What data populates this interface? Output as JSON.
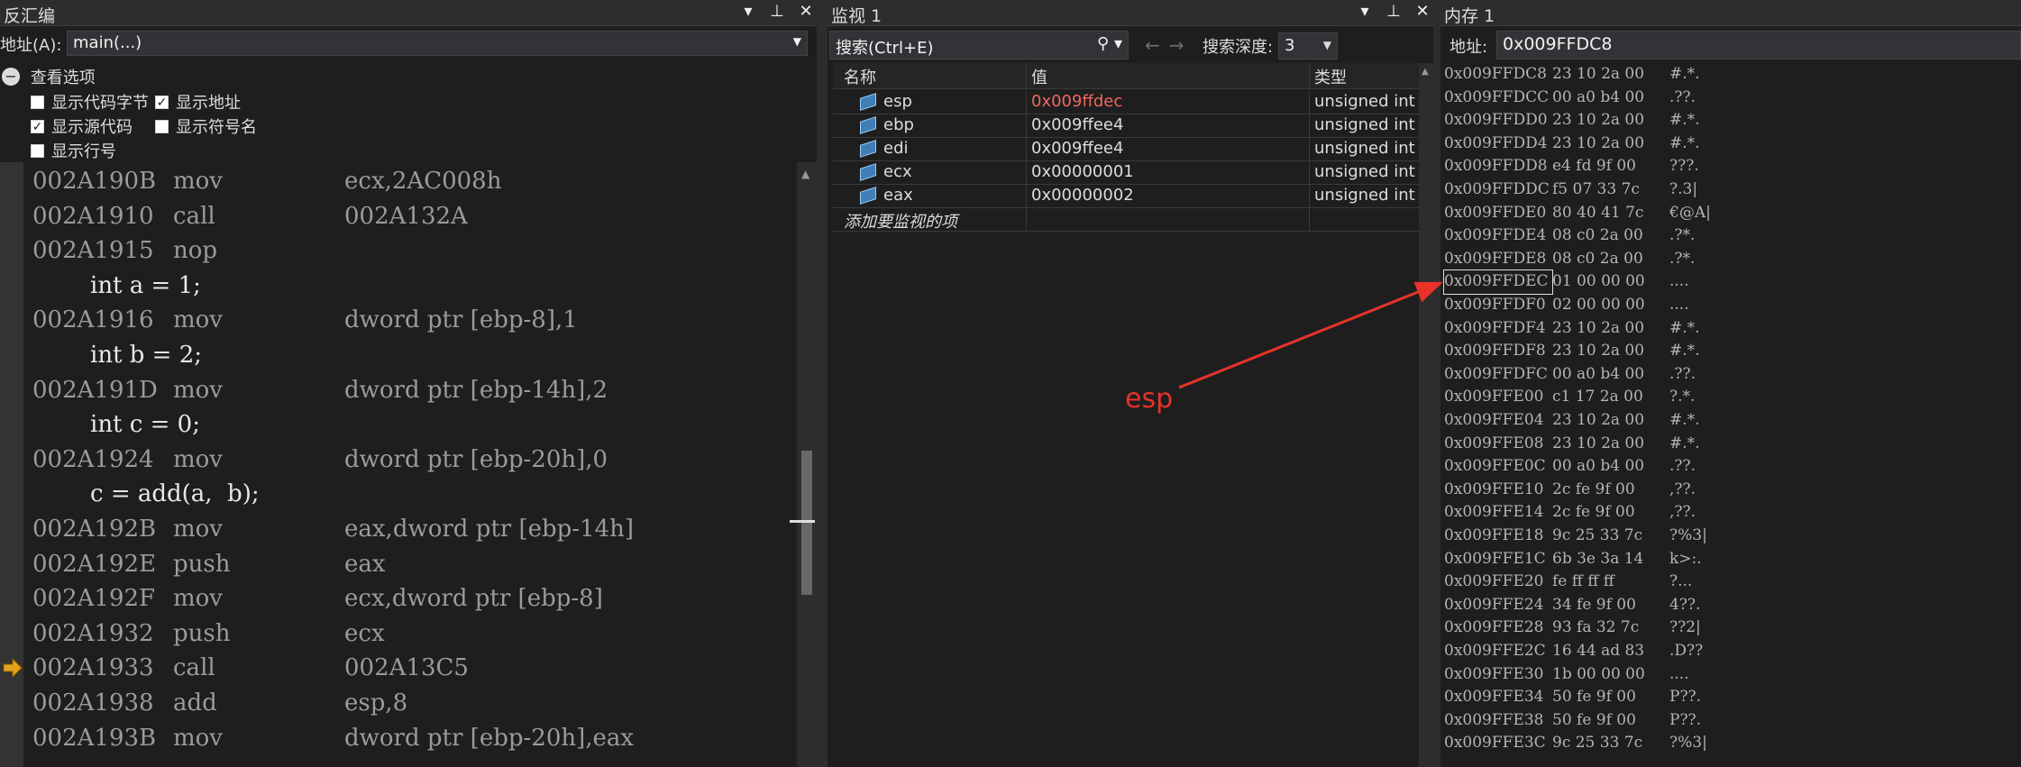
{
  "disassembly": {
    "title": "反汇编",
    "address_label": "地址(A):",
    "address_value": "main(...)",
    "options_header": "查看选项",
    "options": [
      {
        "label": "显示代码字节",
        "checked": false
      },
      {
        "label": "显示地址",
        "checked": true
      },
      {
        "label": "显示源代码",
        "checked": true
      },
      {
        "label": "显示符号名",
        "checked": false
      },
      {
        "label": "显示行号",
        "checked": false
      }
    ],
    "lines": [
      {
        "type": "asm",
        "addr": "002A190B",
        "mnem": "mov",
        "op": "ecx,2AC008h"
      },
      {
        "type": "asm",
        "addr": "002A1910",
        "mnem": "call",
        "op": "002A132A"
      },
      {
        "type": "asm",
        "addr": "002A1915",
        "mnem": "nop",
        "op": ""
      },
      {
        "type": "src",
        "text": "int a = 1;"
      },
      {
        "type": "asm",
        "addr": "002A1916",
        "mnem": "mov",
        "op": "dword ptr [ebp-8],1"
      },
      {
        "type": "src",
        "text": "int b = 2;"
      },
      {
        "type": "asm",
        "addr": "002A191D",
        "mnem": "mov",
        "op": "dword ptr [ebp-14h],2"
      },
      {
        "type": "src",
        "text": "int c = 0;"
      },
      {
        "type": "asm",
        "addr": "002A1924",
        "mnem": "mov",
        "op": "dword ptr [ebp-20h],0"
      },
      {
        "type": "src",
        "text": "c = add(a,  b);"
      },
      {
        "type": "asm",
        "addr": "002A192B",
        "mnem": "mov",
        "op": "eax,dword ptr [ebp-14h]"
      },
      {
        "type": "asm",
        "addr": "002A192E",
        "mnem": "push",
        "op": "eax"
      },
      {
        "type": "asm",
        "addr": "002A192F",
        "mnem": "mov",
        "op": "ecx,dword ptr [ebp-8]"
      },
      {
        "type": "asm",
        "addr": "002A1932",
        "mnem": "push",
        "op": "ecx"
      },
      {
        "type": "asm",
        "addr": "002A1933",
        "mnem": "call",
        "op": "002A13C5",
        "current": true
      },
      {
        "type": "asm",
        "addr": "002A1938",
        "mnem": "add",
        "op": "esp,8"
      },
      {
        "type": "asm",
        "addr": "002A193B",
        "mnem": "mov",
        "op": "dword ptr [ebp-20h],eax"
      }
    ]
  },
  "watch": {
    "title": "监视 1",
    "search_placeholder": "搜索(Ctrl+E)",
    "depth_label": "搜索深度:",
    "depth_value": "3",
    "columns": {
      "name": "名称",
      "value": "值",
      "type": "类型"
    },
    "rows": [
      {
        "name": "esp",
        "value": "0x009ffdec",
        "type": "unsigned int",
        "changed": true
      },
      {
        "name": "ebp",
        "value": "0x009ffee4",
        "type": "unsigned int",
        "changed": false
      },
      {
        "name": "edi",
        "value": "0x009ffee4",
        "type": "unsigned int",
        "changed": false
      },
      {
        "name": "ecx",
        "value": "0x00000001",
        "type": "unsigned int",
        "changed": false
      },
      {
        "name": "eax",
        "value": "0x00000002",
        "type": "unsigned int",
        "changed": false
      }
    ],
    "add_item": "添加要监视的项",
    "annotation": "esp",
    "colors": {
      "changed": "#f0685c",
      "annotation": "#e8322a"
    }
  },
  "memory": {
    "title": "内存 1",
    "address_label": "地址:",
    "address_value": "0x009FFDC8",
    "lines": [
      {
        "addr": "0x009FFDC8",
        "bytes": "23 10 2a 00",
        "ascii": "#.*."
      },
      {
        "addr": "0x009FFDCC",
        "bytes": "00 a0 b4 00",
        "ascii": ".??."
      },
      {
        "addr": "0x009FFDD0",
        "bytes": "23 10 2a 00",
        "ascii": "#.*."
      },
      {
        "addr": "0x009FFDD4",
        "bytes": "23 10 2a 00",
        "ascii": "#.*."
      },
      {
        "addr": "0x009FFDD8",
        "bytes": "e4 fd 9f 00",
        "ascii": "???."
      },
      {
        "addr": "0x009FFDDC",
        "bytes": "f5 07 33 7c",
        "ascii": "?.3|"
      },
      {
        "addr": "0x009FFDE0",
        "bytes": "80 40 41 7c",
        "ascii": "€@A|"
      },
      {
        "addr": "0x009FFDE4",
        "bytes": "08 c0 2a 00",
        "ascii": ".?*."
      },
      {
        "addr": "0x009FFDE8",
        "bytes": "08 c0 2a 00",
        "ascii": ".?*."
      },
      {
        "addr": "0x009FFDEC",
        "bytes": "01 00 00 00",
        "ascii": "....",
        "cursor": true
      },
      {
        "addr": "0x009FFDF0",
        "bytes": "02 00 00 00",
        "ascii": "...."
      },
      {
        "addr": "0x009FFDF4",
        "bytes": "23 10 2a 00",
        "ascii": "#.*."
      },
      {
        "addr": "0x009FFDF8",
        "bytes": "23 10 2a 00",
        "ascii": "#.*."
      },
      {
        "addr": "0x009FFDFC",
        "bytes": "00 a0 b4 00",
        "ascii": ".??."
      },
      {
        "addr": "0x009FFE00",
        "bytes": "c1 17 2a 00",
        "ascii": "?.*."
      },
      {
        "addr": "0x009FFE04",
        "bytes": "23 10 2a 00",
        "ascii": "#.*."
      },
      {
        "addr": "0x009FFE08",
        "bytes": "23 10 2a 00",
        "ascii": "#.*."
      },
      {
        "addr": "0x009FFE0C",
        "bytes": "00 a0 b4 00",
        "ascii": ".??."
      },
      {
        "addr": "0x009FFE10",
        "bytes": "2c fe 9f 00",
        "ascii": ",??."
      },
      {
        "addr": "0x009FFE14",
        "bytes": "2c fe 9f 00",
        "ascii": ",??."
      },
      {
        "addr": "0x009FFE18",
        "bytes": "9c 25 33 7c",
        "ascii": "?%3|"
      },
      {
        "addr": "0x009FFE1C",
        "bytes": "6b 3e 3a 14",
        "ascii": "k>:."
      },
      {
        "addr": "0x009FFE20",
        "bytes": "fe ff ff ff",
        "ascii": "?..."
      },
      {
        "addr": "0x009FFE24",
        "bytes": "34 fe 9f 00",
        "ascii": "4??."
      },
      {
        "addr": "0x009FFE28",
        "bytes": "93 fa 32 7c",
        "ascii": "??2|"
      },
      {
        "addr": "0x009FFE2C",
        "bytes": "16 44 ad 83",
        "ascii": ".D??"
      },
      {
        "addr": "0x009FFE30",
        "bytes": "1b 00 00 00",
        "ascii": "...."
      },
      {
        "addr": "0x009FFE34",
        "bytes": "50 fe 9f 00",
        "ascii": "P??."
      },
      {
        "addr": "0x009FFE38",
        "bytes": "50 fe 9f 00",
        "ascii": "P??."
      },
      {
        "addr": "0x009FFE3C",
        "bytes": "9c 25 33 7c",
        "ascii": "?%3|"
      }
    ]
  }
}
